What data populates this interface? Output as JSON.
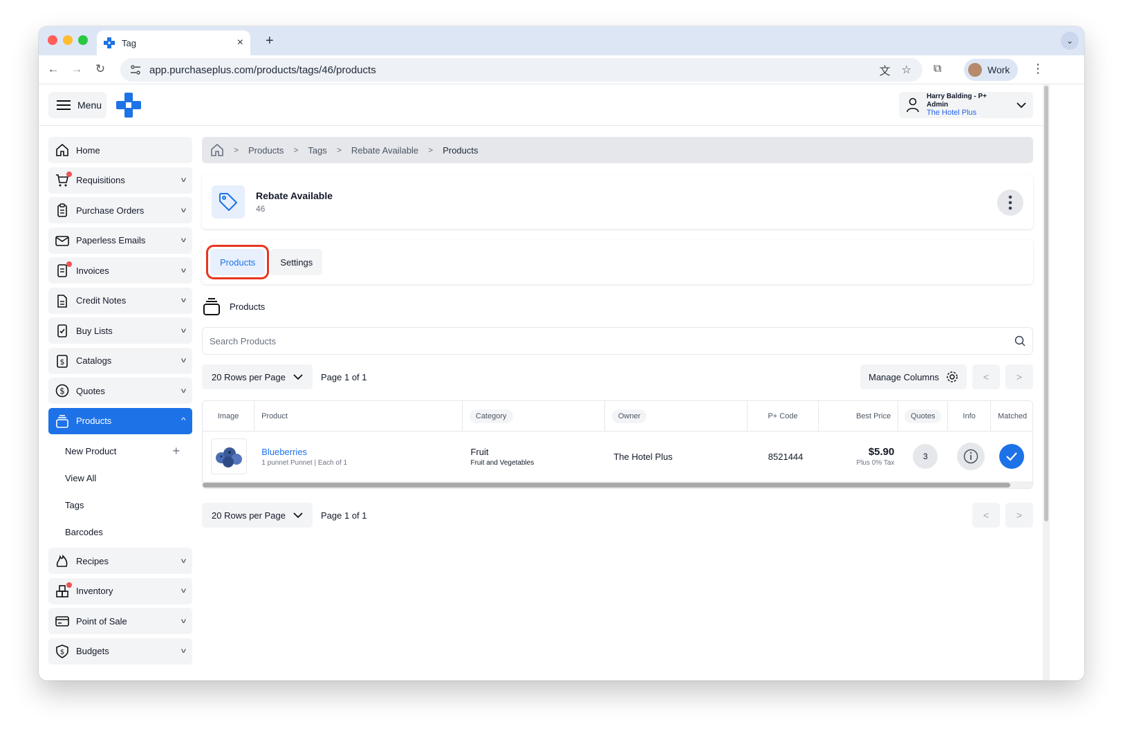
{
  "browser": {
    "tab_title": "Tag",
    "url": "app.purchaseplus.com/products/tags/46/products",
    "profile_label": "Work"
  },
  "header": {
    "menu_label": "Menu",
    "user_name": "Harry Balding - P+ Admin",
    "org_name": "The Hotel Plus"
  },
  "sidebar": {
    "items": [
      {
        "label": "Home",
        "icon": "home-icon",
        "dot": false
      },
      {
        "label": "Requisitions",
        "icon": "cart-icon",
        "dot": true
      },
      {
        "label": "Purchase Orders",
        "icon": "clipboard-icon",
        "dot": false
      },
      {
        "label": "Paperless Emails",
        "icon": "mail-icon",
        "dot": false
      },
      {
        "label": "Invoices",
        "icon": "invoice-icon",
        "dot": true
      },
      {
        "label": "Credit Notes",
        "icon": "document-icon",
        "dot": false
      },
      {
        "label": "Buy Lists",
        "icon": "checklist-icon",
        "dot": false
      },
      {
        "label": "Catalogs",
        "icon": "catalog-icon",
        "dot": false
      },
      {
        "label": "Quotes",
        "icon": "dollar-circle-icon",
        "dot": false
      },
      {
        "label": "Products",
        "icon": "products-icon",
        "dot": false,
        "active": true
      }
    ],
    "products_sub": [
      {
        "label": "New Product"
      },
      {
        "label": "View All"
      },
      {
        "label": "Tags"
      },
      {
        "label": "Barcodes"
      }
    ],
    "items_after": [
      {
        "label": "Recipes",
        "icon": "flame-icon",
        "dot": false
      },
      {
        "label": "Inventory",
        "icon": "boxes-icon",
        "dot": true
      },
      {
        "label": "Point of Sale",
        "icon": "pos-icon",
        "dot": false
      },
      {
        "label": "Budgets",
        "icon": "shield-dollar-icon",
        "dot": false
      }
    ]
  },
  "breadcrumb": [
    "Products",
    "Tags",
    "Rebate Available",
    "Products"
  ],
  "tag": {
    "name": "Rebate Available",
    "id": "46"
  },
  "tabs": [
    {
      "label": "Products",
      "active": true
    },
    {
      "label": "Settings",
      "active": false
    }
  ],
  "section_title": "Products",
  "search": {
    "placeholder": "Search Products"
  },
  "pager": {
    "rows_label": "20 Rows per Page",
    "page_text": "Page 1 of 1",
    "manage_columns": "Manage Columns"
  },
  "table": {
    "columns": [
      "Image",
      "Product",
      "Category",
      "Owner",
      "P+ Code",
      "Best Price",
      "Quotes",
      "Info",
      "Matched"
    ],
    "rows": [
      {
        "product_name": "Blueberries",
        "product_unit": "1 punnet Punnet",
        "product_pack": "Each of 1",
        "category": "Fruit",
        "subcategory": "Fruit and Vegetables",
        "owner": "The Hotel Plus",
        "code": "8521444",
        "price": "$5.90",
        "tax": "Plus 0% Tax",
        "quotes": "3"
      }
    ]
  },
  "colors": {
    "accent": "#1d72e8",
    "highlight": "#e8351f",
    "alert_dot": "#f05252"
  }
}
